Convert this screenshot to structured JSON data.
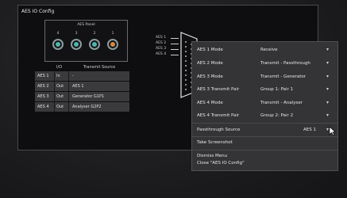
{
  "panel": {
    "title": "AES IO Config",
    "rear_panel_title": "AES Panel",
    "connectors": [
      {
        "number": "4",
        "color": "#4fb6b1"
      },
      {
        "number": "3",
        "color": "#4fb6b1"
      },
      {
        "number": "2",
        "color": "#4fb6b1"
      },
      {
        "number": "1",
        "color": "#d98a3e"
      }
    ],
    "headers": {
      "io": "I/O",
      "source": "Transmit Source"
    },
    "rows": [
      {
        "name": "AES 1",
        "io": "In",
        "source": "-"
      },
      {
        "name": "AES 2",
        "io": "Out",
        "source": "AES 1"
      },
      {
        "name": "AES 3",
        "io": "Out",
        "source": "Generator G1P1"
      },
      {
        "name": "AES 4",
        "io": "Out",
        "source": "Analyser G2P2"
      }
    ],
    "dsub_labels": [
      "AES 1",
      "AES 2",
      "AES 3",
      "AES 4"
    ]
  },
  "menu": {
    "settings": [
      {
        "label": "AES 1 Mode",
        "value": "Receive"
      },
      {
        "label": "AES 2 Mode",
        "value": "Transmit - Passthrough"
      },
      {
        "label": "AES 3 Mode",
        "value": "Transmit - Generator"
      },
      {
        "label": "AES 3 Transmit Pair",
        "value": "Group 1: Pair 1"
      },
      {
        "label": "AES 4 Mode",
        "value": "Transmit - Analyser"
      },
      {
        "label": "AES 4 Transmit Pair",
        "value": "Group 2: Pair 2"
      }
    ],
    "passthrough_label": "Passthrough Source",
    "passthrough_value": "AES 1",
    "take_screenshot": "Take Screenshot",
    "dismiss": "Dismiss Menu",
    "close": "Close \"AES IO Config\""
  },
  "colors": {
    "connector_teal": "#4fb6b1",
    "connector_orange": "#d98a3e",
    "menu_bg": "#343437"
  }
}
